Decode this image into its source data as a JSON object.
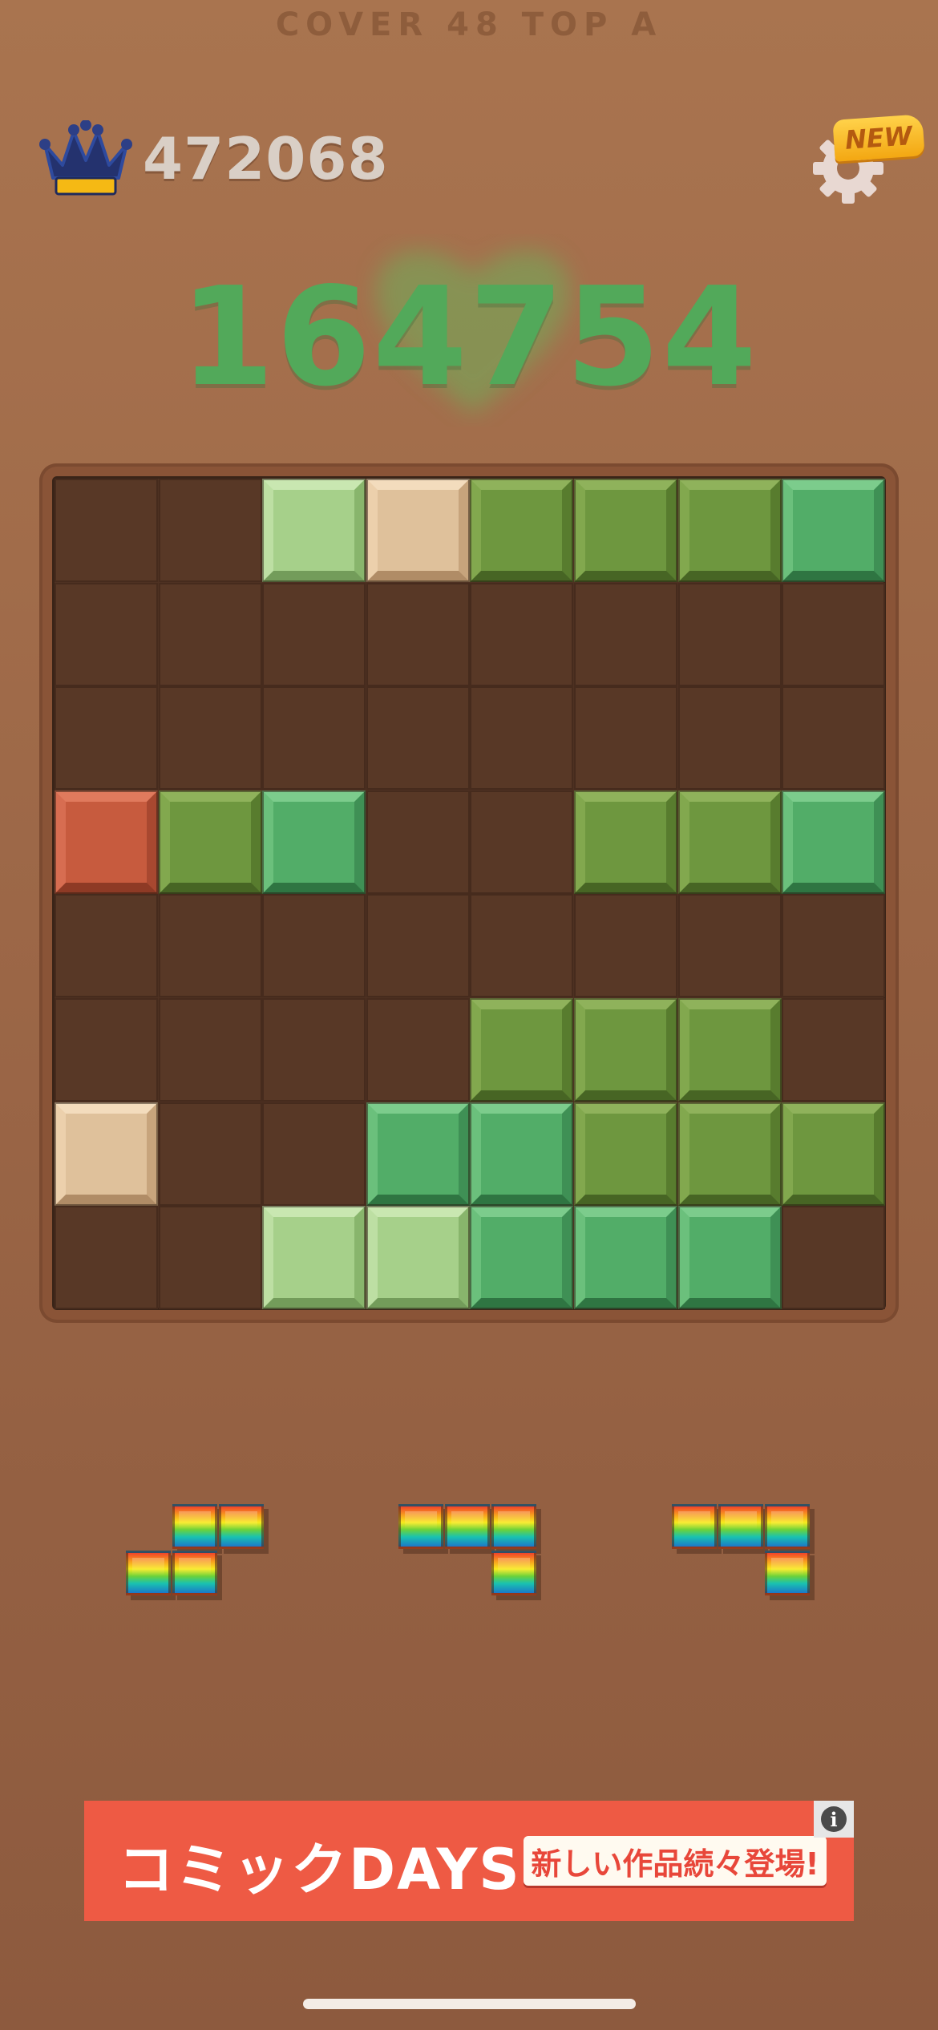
{
  "header": {
    "ghost_text": "COVER 48 TOP A",
    "best_score": "472068",
    "current_score": "164754",
    "settings_badge": "NEW"
  },
  "colors": {
    "olive": "#6f9a3f",
    "green": "#52b068",
    "light_green": "#a6d18a",
    "beige": "#e0c09a",
    "red": "#c85a3e",
    "empty": "#583826"
  },
  "board": {
    "size": 8,
    "rows": [
      [
        "",
        "",
        "light_green",
        "beige",
        "olive",
        "olive",
        "olive",
        "green"
      ],
      [
        "",
        "",
        "",
        "",
        "",
        "",
        "",
        ""
      ],
      [
        "",
        "",
        "",
        "",
        "",
        "",
        "",
        ""
      ],
      [
        "red",
        "olive",
        "green",
        "",
        "",
        "olive",
        "olive",
        "green"
      ],
      [
        "",
        "",
        "",
        "",
        "",
        "",
        "",
        ""
      ],
      [
        "",
        "",
        "",
        "",
        "olive",
        "olive",
        "olive",
        ""
      ],
      [
        "beige",
        "",
        "",
        "green",
        "green",
        "olive",
        "olive",
        "olive"
      ],
      [
        "",
        "",
        "light_green",
        "light_green",
        "green",
        "green",
        "green",
        ""
      ]
    ]
  },
  "pieces": [
    {
      "name": "piece-s-shape",
      "cells": [
        [
          1,
          0
        ],
        [
          2,
          0
        ],
        [
          0,
          1
        ],
        [
          1,
          1
        ]
      ]
    },
    {
      "name": "piece-j-shape-1",
      "cells": [
        [
          0,
          0
        ],
        [
          1,
          0
        ],
        [
          2,
          0
        ],
        [
          2,
          1
        ]
      ]
    },
    {
      "name": "piece-j-shape-2",
      "cells": [
        [
          0,
          0
        ],
        [
          1,
          0
        ],
        [
          2,
          0
        ],
        [
          2,
          1
        ]
      ]
    }
  ],
  "ad": {
    "logo": "コミックDAYS",
    "tagline": "新しい作品続々登場!",
    "info": "i"
  }
}
